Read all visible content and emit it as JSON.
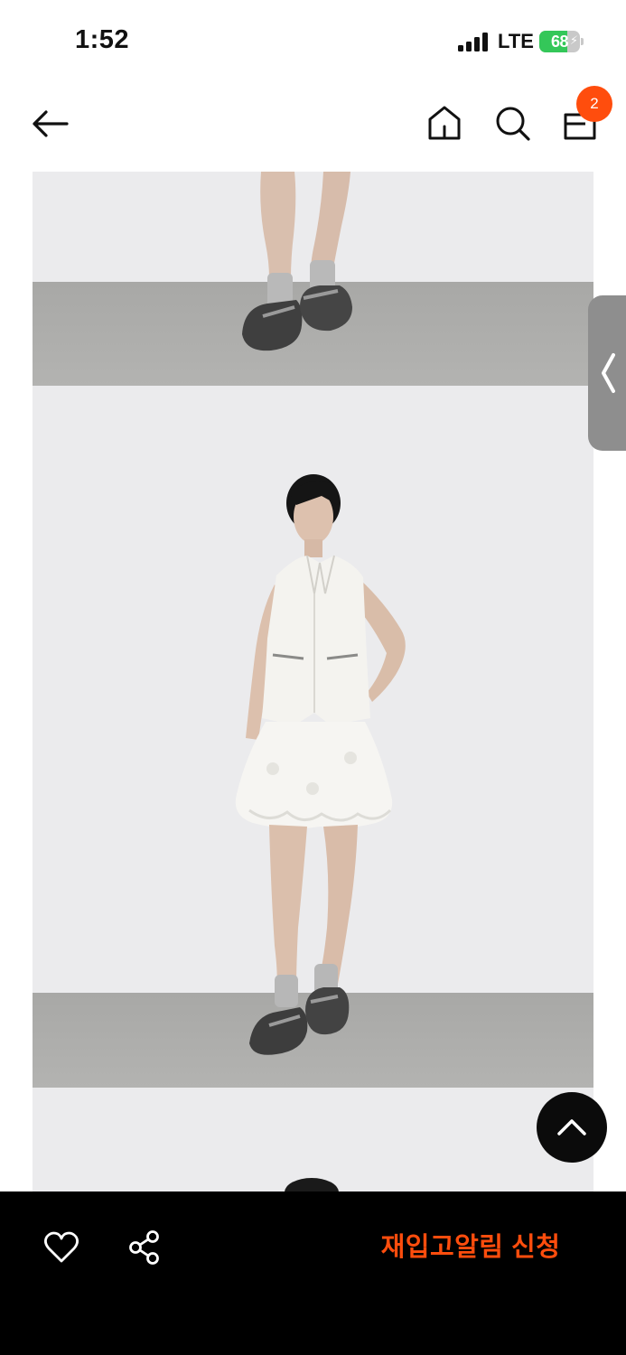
{
  "status_bar": {
    "time": "1:52",
    "network": "LTE",
    "battery_percent": "68",
    "battery_level": 0.68,
    "signal_icon": "signal-bars-icon",
    "battery_icon": "battery-charging-icon"
  },
  "header": {
    "back_icon": "arrow-left-icon",
    "home_icon": "home-icon",
    "search_icon": "search-icon",
    "cart_icon": "shopping-bag-icon",
    "cart_count": "2"
  },
  "gallery": {
    "images": [
      {
        "name": "product-photo-legs-crop"
      },
      {
        "name": "product-photo-full-outfit"
      },
      {
        "name": "product-photo-next"
      }
    ],
    "side_tab_icon": "chevron-left-icon"
  },
  "scroll_top_icon": "chevron-up-icon",
  "bottom_bar": {
    "wishlist_icon": "heart-icon",
    "share_icon": "share-icon",
    "restock_label": "재입고알림 신청"
  },
  "colors": {
    "accent": "#ff4d0d",
    "bar_background": "#000000",
    "battery_green": "#34c759"
  }
}
